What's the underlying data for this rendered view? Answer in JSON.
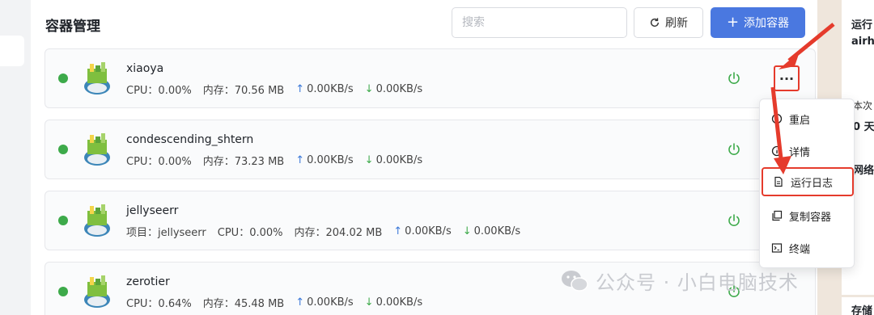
{
  "header": {
    "title": "容器管理",
    "search_placeholder": "搜索",
    "refresh_label": "刷新",
    "add_label": "添加容器"
  },
  "containers": [
    {
      "name": "xiaoya",
      "project": "",
      "cpu": "CPU：0.00%",
      "mem": "内存：70.56 MB",
      "up": "0.00KB/s",
      "down": "0.00KB/s",
      "status": "running"
    },
    {
      "name": "condescending_shtern",
      "project": "",
      "cpu": "CPU：0.00%",
      "mem": "内存：73.23 MB",
      "up": "0.00KB/s",
      "down": "0.00KB/s",
      "status": "running"
    },
    {
      "name": "jellyseerr",
      "project": "项目：jellyseerr",
      "cpu": "CPU：0.00%",
      "mem": "内存：204.02 MB",
      "up": "0.00KB/s",
      "down": "0.00KB/s",
      "status": "running"
    },
    {
      "name": "zerotier",
      "project": "",
      "cpu": "CPU：0.64%",
      "mem": "内存：45.48 MB",
      "up": "0.00KB/s",
      "down": "0.00KB/s",
      "status": "running"
    }
  ],
  "menu": {
    "items": [
      {
        "label": "重启",
        "icon": "restart-icon"
      },
      {
        "label": "详情",
        "icon": "info-icon"
      },
      {
        "label": "运行日志",
        "icon": "log-icon"
      },
      {
        "label": "复制容器",
        "icon": "copy-icon"
      },
      {
        "label": "终端",
        "icon": "terminal-icon"
      }
    ]
  },
  "right_panel": {
    "t1": "运行",
    "t2": "airh",
    "t3": "本次",
    "t4": "0 天",
    "t5": "网络",
    "t6": "存储"
  },
  "watermark": "公众号 · 小白电脑技术",
  "more_label": "···",
  "colors": {
    "accent": "#4a78e0",
    "running": "#3daa4a",
    "annotation": "#e53b2c"
  }
}
